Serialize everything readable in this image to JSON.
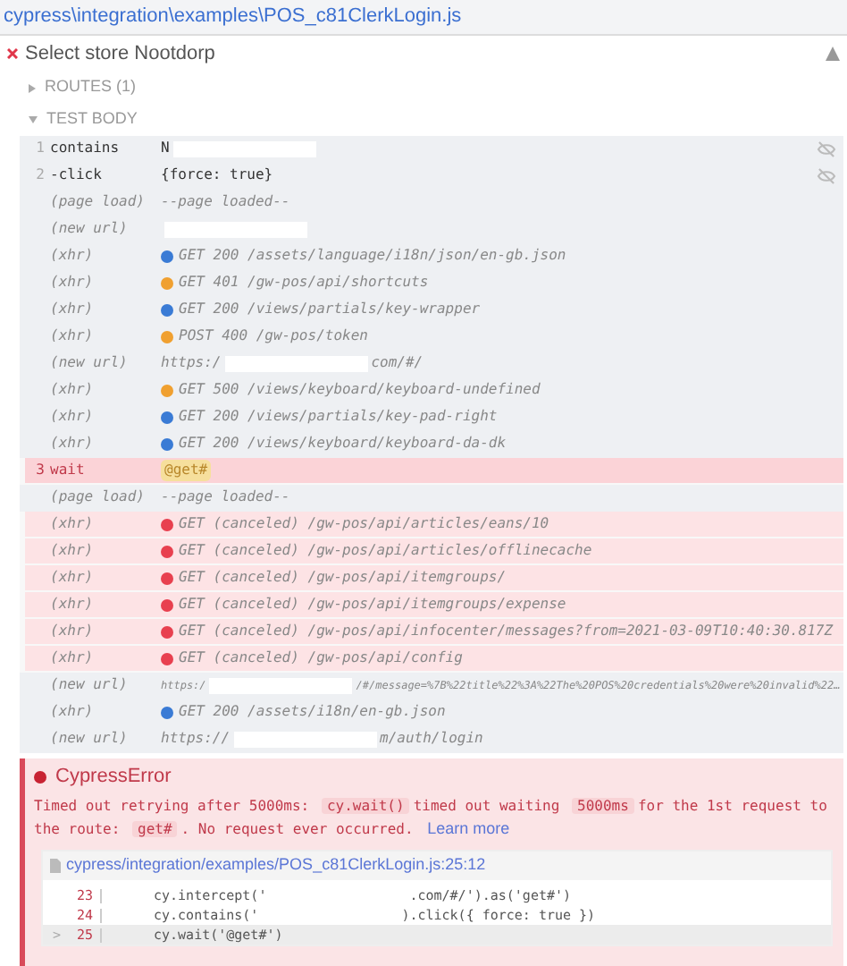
{
  "header": {
    "file_path": "cypress\\integration\\examples\\POS_c81ClerkLogin.js"
  },
  "test": {
    "title": "Select store Nootdorp",
    "failed": true
  },
  "sections": [
    {
      "label": "ROUTES (1)",
      "expanded": false
    },
    {
      "label": "TEST BODY",
      "expanded": true
    }
  ],
  "rows": [
    {
      "kind": "command",
      "number": "1",
      "name": "contains",
      "message": "N",
      "message_end": "",
      "failed": false,
      "hidden_icon": true
    },
    {
      "kind": "command",
      "number": "2",
      "name": "-click",
      "message": "{force: true}",
      "failed": false,
      "hidden_icon": true
    },
    {
      "kind": "event",
      "name": "(page load)",
      "message": "--page loaded--",
      "failed": false
    },
    {
      "kind": "event",
      "name": "(new url)",
      "message": "",
      "message_end": "",
      "failed": false
    },
    {
      "kind": "event",
      "name": "(xhr)",
      "color": "#3a7bd5",
      "message": "GET 200 /assets/language/i18n/json/en-gb.json",
      "failed": false
    },
    {
      "kind": "event",
      "name": "(xhr)",
      "color": "#f0a030",
      "message": "GET 401 /gw-pos/api/shortcuts",
      "failed": false
    },
    {
      "kind": "event",
      "name": "(xhr)",
      "color": "#3a7bd5",
      "message": "GET 200 /views/partials/key-wrapper",
      "failed": false
    },
    {
      "kind": "event",
      "name": "(xhr)",
      "color": "#f0a030",
      "message": "POST 400 /gw-pos/token",
      "failed": false
    },
    {
      "kind": "event",
      "name": "(new url)",
      "message": "https:/",
      "message_end": "com/#/",
      "failed": false
    },
    {
      "kind": "event",
      "name": "(xhr)",
      "color": "#f0a030",
      "message": "GET 500 /views/keyboard/keyboard-undefined",
      "failed": false
    },
    {
      "kind": "event",
      "name": "(xhr)",
      "color": "#3a7bd5",
      "message": "GET 200 /views/partials/key-pad-right",
      "failed": false
    },
    {
      "kind": "event",
      "name": "(xhr)",
      "color": "#3a7bd5",
      "message": "GET 200 /views/keyboard/keyboard-da-dk",
      "failed": false
    },
    {
      "kind": "command",
      "number": "3",
      "name": "wait",
      "alias": "@get#",
      "failed": true
    },
    {
      "kind": "event",
      "name": "(page load)",
      "message": "--page loaded--",
      "failed": false
    },
    {
      "kind": "event",
      "name": "(xhr)",
      "color": "#e8404f",
      "message": "GET (canceled) /gw-pos/api/articles/eans/10",
      "failed": true
    },
    {
      "kind": "event",
      "name": "(xhr)",
      "color": "#e8404f",
      "message": "GET (canceled) /gw-pos/api/articles/offlinecache",
      "failed": true
    },
    {
      "kind": "event",
      "name": "(xhr)",
      "color": "#e8404f",
      "message": "GET (canceled) /gw-pos/api/itemgroups/",
      "failed": true
    },
    {
      "kind": "event",
      "name": "(xhr)",
      "color": "#e8404f",
      "message": "GET (canceled) /gw-pos/api/itemgroups/expense",
      "failed": true
    },
    {
      "kind": "event",
      "name": "(xhr)",
      "color": "#e8404f",
      "message": "GET (canceled) /gw-pos/api/infocenter/messages?from=2021-03-09T10:40:30.817Z",
      "failed": true
    },
    {
      "kind": "event",
      "name": "(xhr)",
      "color": "#e8404f",
      "message": "GET (canceled) /gw-pos/api/config",
      "failed": true
    },
    {
      "kind": "event",
      "name": "(new url)",
      "message": "https:/",
      "message_end": "/#/message=%7B%22title%22%3A%22The%20POS%20credentials%20were%20invalid%22…",
      "small": true,
      "failed": false
    },
    {
      "kind": "event",
      "name": "(xhr)",
      "color": "#3a7bd5",
      "message": "GET 200 /assets/i18n/en-gb.json",
      "failed": false
    },
    {
      "kind": "event",
      "name": "(new url)",
      "message": "https://",
      "message_end": "m/auth/login",
      "failed": false
    }
  ],
  "error": {
    "title": "CypressError",
    "message": [
      {
        "kind": "text",
        "text": "Timed out retrying after 5000ms:"
      },
      {
        "kind": "code",
        "text": "cy.wait()"
      },
      {
        "kind": "text",
        "text": "timed out waiting"
      },
      {
        "kind": "code",
        "text": "5000ms"
      },
      {
        "kind": "text",
        "text": "for the 1st request to the route:"
      },
      {
        "kind": "code",
        "text": "get#"
      },
      {
        "kind": "text",
        "text": ". No request ever occurred."
      },
      {
        "kind": "link",
        "text": "Learn more"
      }
    ],
    "file_link": "cypress/integration/examples/POS_c81ClerkLogin.js:25:12",
    "code_lines": [
      {
        "number": "23",
        "code": "cy.intercept('",
        "code_end": ".com/#/').as('get#')",
        "current": false
      },
      {
        "number": "24",
        "code": "cy.contains('",
        "code_end": ").click({ force: true })",
        "current": false
      },
      {
        "number": "25",
        "marker": ">",
        "code": "cy.wait('@get#')",
        "current": true
      }
    ]
  }
}
